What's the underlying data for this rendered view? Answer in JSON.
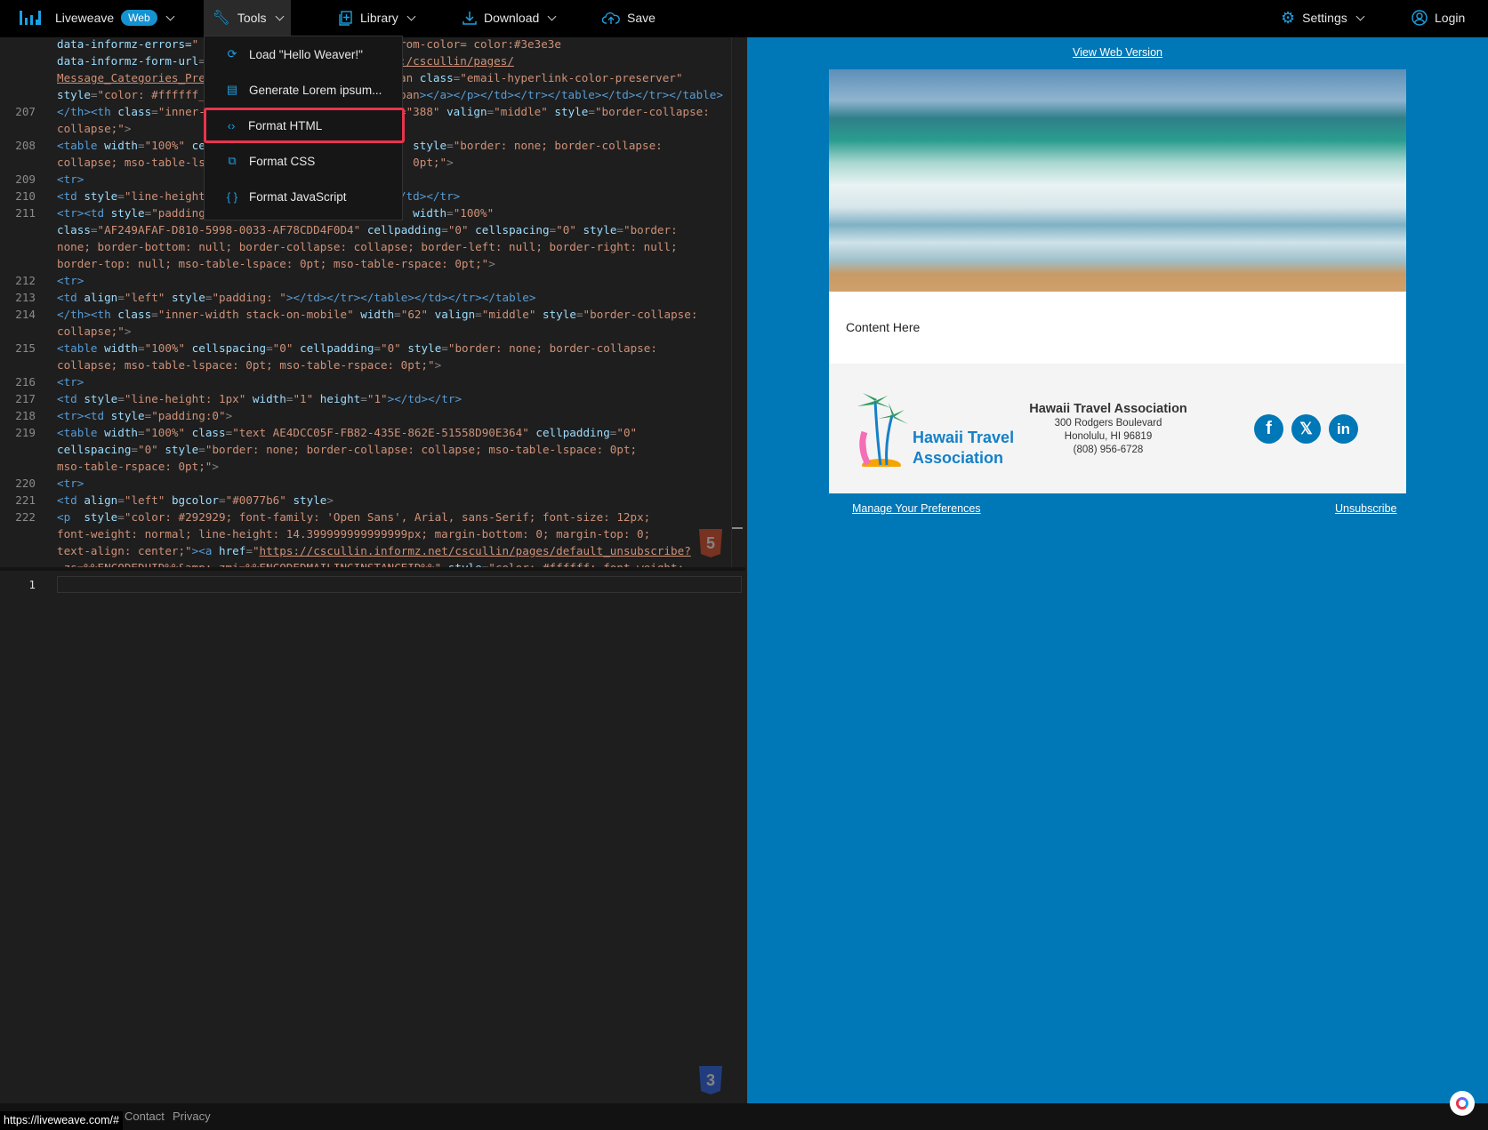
{
  "topbar": {
    "brand": "Liveweave",
    "badge": "Web",
    "tools": "Tools",
    "library": "Library",
    "download": "Download",
    "save": "Save",
    "settings": "Settings",
    "login": "Login"
  },
  "tools_menu": [
    {
      "label": "Load \"Hello Weaver!\"",
      "icon": "reload-icon"
    },
    {
      "label": "Generate Lorem ipsum...",
      "icon": "document-icon"
    },
    {
      "label": "Format HTML",
      "icon": "code-icon",
      "selected": true
    },
    {
      "label": "Format CSS",
      "icon": "css-file-icon"
    },
    {
      "label": "Format JavaScript",
      "icon": "braces-icon"
    }
  ],
  "code_rows": [
    {
      "n": "",
      "l": [
        [
          "a",
          "data-informz-errors="
        ],
        [
          "s",
          "\""
        ]
      ],
      "r": [
        [
          "s",
          "rom-color= color:#3e3e3e"
        ]
      ]
    },
    {
      "n": "",
      "l": [
        [
          "a",
          "data-informz-form-url"
        ],
        [
          "p",
          "="
        ]
      ],
      "r": [
        [
          "u",
          ":/cscullin/pages/"
        ]
      ]
    },
    {
      "n": "",
      "l": [
        [
          "u",
          "Message_Categories_Pre"
        ]
      ],
      "r": [
        [
          "s",
          "an "
        ],
        [
          "a",
          "class"
        ],
        [
          "p",
          "="
        ],
        [
          "s",
          "\"email-hyperlink-color-preserver\""
        ]
      ]
    },
    {
      "n": "",
      "l": [
        [
          "a",
          "style"
        ],
        [
          "p",
          "="
        ],
        [
          "s",
          "\"color: #ffffff_"
        ]
      ],
      "r": [
        [
          "s",
          "pan"
        ],
        [
          "t",
          "></a></p></td></tr></table></td></tr></table>"
        ]
      ]
    },
    {
      "n": "207",
      "l": [
        [
          "t",
          "</th><th "
        ],
        [
          "a",
          "class"
        ],
        [
          "p",
          "="
        ],
        [
          "s",
          "\"inner-"
        ]
      ],
      "r": [
        [
          "s",
          "=\"388\" "
        ],
        [
          "a",
          "valign"
        ],
        [
          "p",
          "="
        ],
        [
          "s",
          "\"middle\" "
        ],
        [
          "a",
          "style"
        ],
        [
          "p",
          "="
        ],
        [
          "s",
          "\"border-collapse:"
        ]
      ]
    },
    {
      "n": "",
      "l": [
        [
          "s",
          "collapse;\""
        ],
        [
          "p",
          ">"
        ]
      ],
      "r": []
    },
    {
      "n": "208",
      "l": [
        [
          "t",
          "<table "
        ],
        [
          "a",
          "width"
        ],
        [
          "p",
          "="
        ],
        [
          "s",
          "\"100%\" "
        ],
        [
          "a",
          "ce"
        ]
      ],
      "r": [
        [
          "x",
          "  "
        ],
        [
          "a",
          "style"
        ],
        [
          "p",
          "="
        ],
        [
          "s",
          "\"border: none; border-collapse:"
        ]
      ]
    },
    {
      "n": "",
      "l": [
        [
          "s",
          "collapse; mso-table-ls"
        ]
      ],
      "r": [
        [
          "s",
          "  0pt;\""
        ],
        [
          "p",
          ">"
        ]
      ]
    },
    {
      "n": "209",
      "l": [
        [
          "t",
          "<tr>"
        ]
      ],
      "r": []
    },
    {
      "n": "210",
      "l": [
        [
          "t",
          "<td "
        ],
        [
          "a",
          "style"
        ],
        [
          "p",
          "="
        ],
        [
          "s",
          "\"line-height"
        ]
      ],
      "r": [
        [
          "t",
          "/td></tr>"
        ]
      ]
    },
    {
      "n": "211",
      "l": [
        [
          "t",
          "<tr><td "
        ],
        [
          "a",
          "style"
        ],
        [
          "p",
          "="
        ],
        [
          "s",
          "\"padding"
        ]
      ],
      "r": [
        [
          "x",
          "  "
        ],
        [
          "a",
          "width"
        ],
        [
          "p",
          "="
        ],
        [
          "s",
          "\"100%\""
        ]
      ]
    },
    {
      "n": "",
      "l": [
        [
          "a",
          "class"
        ],
        [
          "p",
          "="
        ],
        [
          "s",
          "\"AF249AFAF-D810-5998-0033-AF78CDD4F0D4\" "
        ],
        [
          "a",
          "cellpadding"
        ],
        [
          "p",
          "="
        ],
        [
          "s",
          "\"0\" "
        ],
        [
          "a",
          "cellspacing"
        ],
        [
          "p",
          "="
        ],
        [
          "s",
          "\"0\" "
        ],
        [
          "a",
          "style"
        ],
        [
          "p",
          "="
        ],
        [
          "s",
          "\"border:"
        ]
      ],
      "r": []
    },
    {
      "n": "",
      "l": [
        [
          "s",
          "none; border-bottom: null; border-collapse: collapse; border-left: null; border-right: null;"
        ]
      ],
      "r": []
    },
    {
      "n": "",
      "l": [
        [
          "s",
          "border-top: null; mso-table-lspace: 0pt; mso-table-rspace: 0pt;\""
        ],
        [
          "p",
          ">"
        ]
      ],
      "r": []
    },
    {
      "n": "212",
      "l": [
        [
          "t",
          "<tr>"
        ]
      ],
      "r": []
    },
    {
      "n": "213",
      "l": [
        [
          "t",
          "<td "
        ],
        [
          "a",
          "align"
        ],
        [
          "p",
          "="
        ],
        [
          "s",
          "\"left\" "
        ],
        [
          "a",
          "style"
        ],
        [
          "p",
          "="
        ],
        [
          "s",
          "\"padding: \""
        ],
        [
          "t",
          "></td></tr></table></td></tr></table>"
        ]
      ],
      "r": []
    },
    {
      "n": "214",
      "l": [
        [
          "t",
          "</th><th "
        ],
        [
          "a",
          "class"
        ],
        [
          "p",
          "="
        ],
        [
          "s",
          "\"inner-width stack-on-mobile\" "
        ],
        [
          "a",
          "width"
        ],
        [
          "p",
          "="
        ],
        [
          "s",
          "\"62\" "
        ],
        [
          "a",
          "valign"
        ],
        [
          "p",
          "="
        ],
        [
          "s",
          "\"middle\" "
        ],
        [
          "a",
          "style"
        ],
        [
          "p",
          "="
        ],
        [
          "s",
          "\"border-collapse:"
        ]
      ],
      "r": []
    },
    {
      "n": "",
      "l": [
        [
          "s",
          "collapse;\""
        ],
        [
          "p",
          ">"
        ]
      ],
      "r": []
    },
    {
      "n": "215",
      "l": [
        [
          "t",
          "<table "
        ],
        [
          "a",
          "width"
        ],
        [
          "p",
          "="
        ],
        [
          "s",
          "\"100%\" "
        ],
        [
          "a",
          "cellspacing"
        ],
        [
          "p",
          "="
        ],
        [
          "s",
          "\"0\" "
        ],
        [
          "a",
          "cellpadding"
        ],
        [
          "p",
          "="
        ],
        [
          "s",
          "\"0\" "
        ],
        [
          "a",
          "style"
        ],
        [
          "p",
          "="
        ],
        [
          "s",
          "\"border: none; border-collapse:"
        ]
      ],
      "r": []
    },
    {
      "n": "",
      "l": [
        [
          "s",
          "collapse; mso-table-lspace: 0pt; mso-table-rspace: 0pt;\""
        ],
        [
          "p",
          ">"
        ]
      ],
      "r": []
    },
    {
      "n": "216",
      "l": [
        [
          "t",
          "<tr>"
        ]
      ],
      "r": []
    },
    {
      "n": "217",
      "l": [
        [
          "t",
          "<td "
        ],
        [
          "a",
          "style"
        ],
        [
          "p",
          "="
        ],
        [
          "s",
          "\"line-height: 1px\" "
        ],
        [
          "a",
          "width"
        ],
        [
          "p",
          "="
        ],
        [
          "s",
          "\"1\" "
        ],
        [
          "a",
          "height"
        ],
        [
          "p",
          "="
        ],
        [
          "s",
          "\"1\""
        ],
        [
          "t",
          "></td></tr>"
        ]
      ],
      "r": []
    },
    {
      "n": "218",
      "l": [
        [
          "t",
          "<tr><td "
        ],
        [
          "a",
          "style"
        ],
        [
          "p",
          "="
        ],
        [
          "s",
          "\"padding:0\""
        ],
        [
          "p",
          ">"
        ]
      ],
      "r": []
    },
    {
      "n": "219",
      "l": [
        [
          "t",
          "<table "
        ],
        [
          "a",
          "width"
        ],
        [
          "p",
          "="
        ],
        [
          "s",
          "\"100%\" "
        ],
        [
          "a",
          "class"
        ],
        [
          "p",
          "="
        ],
        [
          "s",
          "\"text AE4DCC05F-FB82-435E-862E-51558D90E364\" "
        ],
        [
          "a",
          "cellpadding"
        ],
        [
          "p",
          "="
        ],
        [
          "s",
          "\"0\""
        ]
      ],
      "r": []
    },
    {
      "n": "",
      "l": [
        [
          "a",
          "cellspacing"
        ],
        [
          "p",
          "="
        ],
        [
          "s",
          "\"0\" "
        ],
        [
          "a",
          "style"
        ],
        [
          "p",
          "="
        ],
        [
          "s",
          "\"border: none; border-collapse: collapse; mso-table-lspace: 0pt;"
        ]
      ],
      "r": []
    },
    {
      "n": "",
      "l": [
        [
          "s",
          "mso-table-rspace: 0pt;\""
        ],
        [
          "p",
          ">"
        ]
      ],
      "r": []
    },
    {
      "n": "220",
      "l": [
        [
          "t",
          "<tr>"
        ]
      ],
      "r": []
    },
    {
      "n": "221",
      "l": [
        [
          "t",
          "<td "
        ],
        [
          "a",
          "align"
        ],
        [
          "p",
          "="
        ],
        [
          "s",
          "\"left\" "
        ],
        [
          "a",
          "bgcolor"
        ],
        [
          "p",
          "="
        ],
        [
          "s",
          "\"#0077b6\" "
        ],
        [
          "a",
          "style"
        ],
        [
          "p",
          ">"
        ]
      ],
      "r": []
    },
    {
      "n": "222",
      "l": [
        [
          "t",
          "<p  "
        ],
        [
          "a",
          "style"
        ],
        [
          "p",
          "="
        ],
        [
          "s",
          "\"color: #292929; font-family: 'Open Sans', Arial, sans-Serif; font-size: 12px;"
        ]
      ],
      "r": []
    },
    {
      "n": "",
      "l": [
        [
          "s",
          "font-weight: normal; line-height: 14.399999999999999px; margin-bottom: 0; margin-top: 0;"
        ]
      ],
      "r": []
    },
    {
      "n": "",
      "l": [
        [
          "s",
          "text-align: center;\""
        ],
        [
          "t",
          "><a "
        ],
        [
          "a",
          "href"
        ],
        [
          "p",
          "="
        ],
        [
          "s",
          "\""
        ],
        [
          "u",
          "https://cscullin.informz.net/cscullin/pages/default_unsubscribe?"
        ]
      ],
      "r": []
    },
    {
      "n": "",
      "l": [
        [
          "u",
          "_zs=%%ENCODEDUID%%&amp;_zmi=%%ENCODEDMAILINGINSTANCEID%%"
        ],
        [
          "s",
          "\" "
        ],
        [
          "a",
          "style"
        ],
        [
          "p",
          "="
        ],
        [
          "s",
          "\"color: #ffffff; font-weight:"
        ]
      ],
      "r": []
    }
  ],
  "css_pane": {
    "line_number": "1"
  },
  "preview": {
    "view_web_version": "View Web Version",
    "content": "Content Here",
    "org_name": "Hawaii Travel Association",
    "logo_line1": "Hawaii Travel",
    "logo_line2": "Association",
    "address1": "300 Rodgers Boulevard",
    "address2": "Honolulu, HI 96819",
    "phone": "(808) 956-6728",
    "social": [
      {
        "name": "facebook",
        "glyph": "f"
      },
      {
        "name": "x",
        "glyph": "𝕏"
      },
      {
        "name": "linkedin",
        "glyph": "in"
      }
    ],
    "manage": "Manage Your Preferences",
    "unsubscribe": "Unsubscribe"
  },
  "footer": {
    "status_url": "https://liveweave.com/#",
    "contact": "Contact",
    "privacy": "Privacy"
  },
  "colors": {
    "accent": "#1593d1",
    "preview_bg": "#0077b6",
    "selected_border": "#e8344e"
  }
}
